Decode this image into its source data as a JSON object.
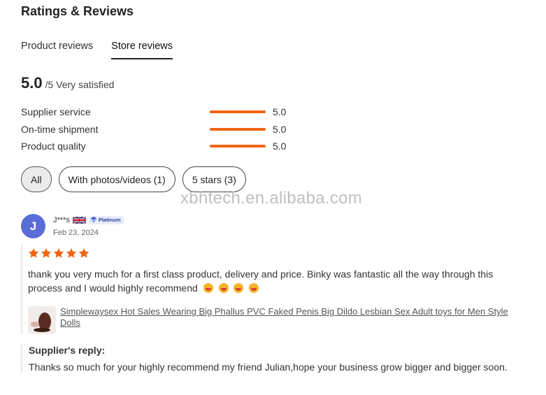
{
  "header": {
    "title": "Ratings & Reviews"
  },
  "tabs": [
    {
      "label": "Product reviews"
    },
    {
      "label": "Store reviews"
    }
  ],
  "summary": {
    "score": "5.0",
    "suffix": "/5 Very satisfied"
  },
  "metrics": [
    {
      "label": "Supplier service",
      "value": "5.0",
      "fraction": 1.0
    },
    {
      "label": "On-time shipment",
      "value": "5.0",
      "fraction": 1.0
    },
    {
      "label": "Product quality",
      "value": "5.0",
      "fraction": 1.0
    }
  ],
  "filters": [
    {
      "label": "All"
    },
    {
      "label": "With photos/videos (1)"
    },
    {
      "label": "5 stars (3)"
    }
  ],
  "watermark": "xbhtech.en.alibaba.com",
  "review": {
    "avatar_letter": "J",
    "name": "J***s",
    "badge": "Platinum",
    "date": "Feb 23, 2024",
    "rating": 5,
    "text": "thank you very much for a first class product, delivery and price. Binky was fantastic all the way through this process and I would highly recommend",
    "product_title": "Simplewaysex Hot Sales Wearing Big Phallus PVC Faked Penis Big Dildo Lesbian Sex Adult toys for Men Style Dolls"
  },
  "reply": {
    "title": "Supplier's reply:",
    "text": "Thanks so much for your highly recommend my friend Julian,hope your business grow bigger and bigger soon."
  },
  "colors": {
    "accent": "#f06411",
    "avatar": "#5a6cd6"
  }
}
